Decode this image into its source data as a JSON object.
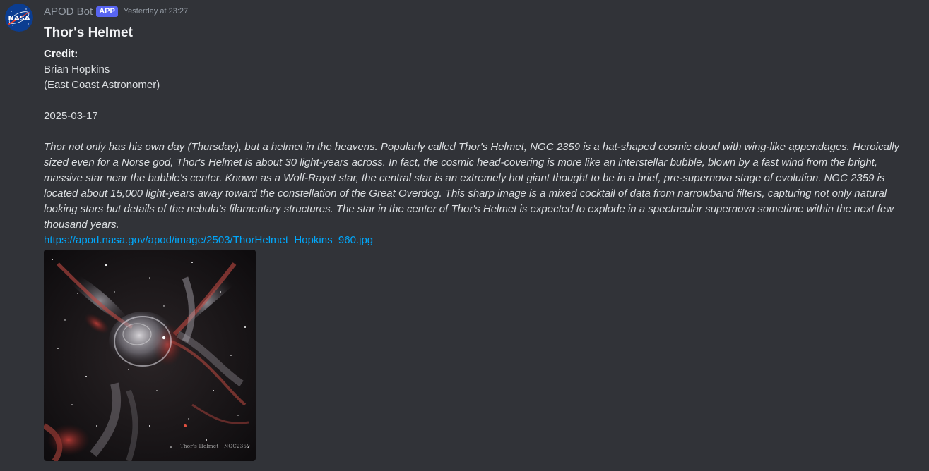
{
  "message": {
    "author": "APOD Bot",
    "badge": "APP",
    "timestamp": "Yesterday at 23:27",
    "avatar_icon": "nasa-logo-icon",
    "title": "Thor's Helmet",
    "credit_label": "Credit:",
    "credit_lines": [
      "Brian Hopkins",
      "(East Coast Astronomer)"
    ],
    "date": "2025-03-17",
    "explanation": "Thor not only has his own day (Thursday), but a helmet in the heavens.  Popularly called Thor's Helmet, NGC 2359 is a hat-shaped cosmic cloud with wing-like appendages. Heroically sized even for a Norse god, Thor's Helmet is about 30 light-years across. In fact, the cosmic head-covering is more like an interstellar bubble, blown by a fast wind from the bright, massive star near the bubble's center. Known as a Wolf-Rayet star, the central star is an extremely hot giant thought to be in a brief, pre-supernova stage of evolution. NGC 2359 is located about 15,000 light-years away toward the constellation of the Great Overdog. This sharp image is a mixed cocktail of data from  narrowband filters, capturing not only natural looking stars but details of the nebula's filamentary structures. The star in the center of Thor's Helmet is expected to explode in a spectacular supernova sometime within the next few thousand years.",
    "link": "https://apod.nasa.gov/apod/image/2503/ThorHelmet_Hopkins_960.jpg",
    "image_caption": "Thor's Helmet · NGC2359"
  },
  "colors": {
    "background": "#313338",
    "link": "#00a8fc",
    "badge": "#5865f2",
    "muted": "#949ba4"
  }
}
